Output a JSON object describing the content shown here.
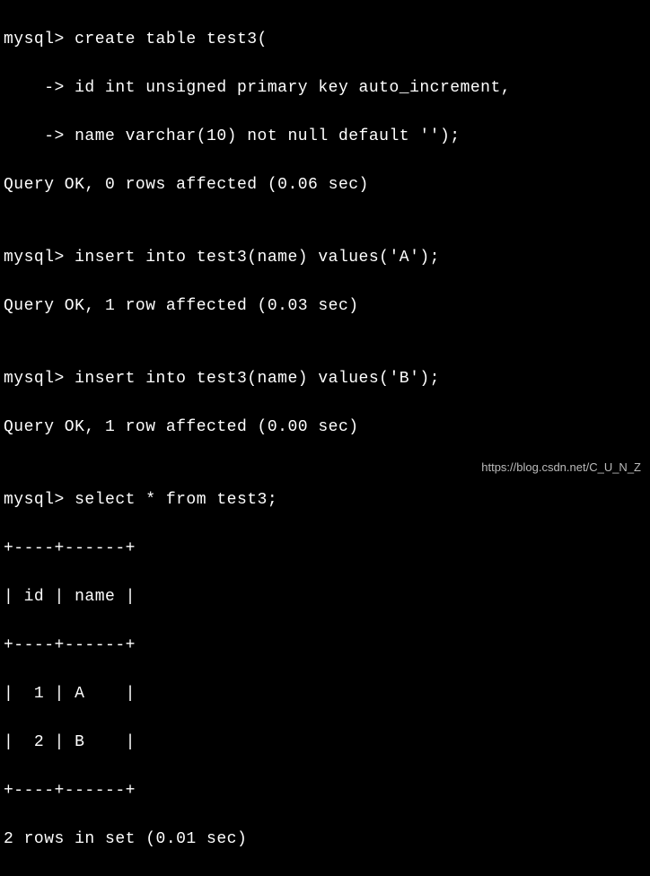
{
  "terminal": {
    "lines": {
      "l0": "mysql> create table test3(",
      "l1": "    -> id int unsigned primary key auto_increment,",
      "l2": "    -> name varchar(10) not null default '');",
      "l3": "Query OK, 0 rows affected (0.06 sec)",
      "l4": "",
      "l5": "mysql> insert into test3(name) values('A');",
      "l6": "Query OK, 1 row affected (0.03 sec)",
      "l7": "",
      "l8": "mysql> insert into test3(name) values('B');",
      "l9": "Query OK, 1 row affected (0.00 sec)",
      "l10": "",
      "l11": "mysql> select * from test3;",
      "l12": "+----+------+",
      "l13": "| id | name |",
      "l14": "+----+------+",
      "l15": "|  1 | A    |",
      "l16": "|  2 | B    |",
      "l17": "+----+------+",
      "l18": "2 rows in set (0.01 sec)"
    }
  },
  "watermark": "https://blog.csdn.net/C_U_N_Z"
}
